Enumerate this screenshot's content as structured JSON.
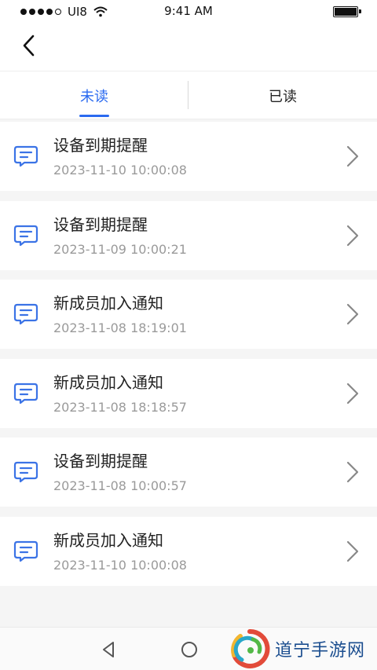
{
  "status_bar": {
    "carrier": "UI8",
    "time": "9:41 AM"
  },
  "tabs": [
    {
      "label": "未读"
    },
    {
      "label": "已读"
    }
  ],
  "messages": [
    {
      "title": "设备到期提醒",
      "time": "2023-11-10 10:00:08"
    },
    {
      "title": "设备到期提醒",
      "time": "2023-11-09 10:00:21"
    },
    {
      "title": "新成员加入通知",
      "time": "2023-11-08 18:19:01"
    },
    {
      "title": "新成员加入通知",
      "time": "2023-11-08 18:18:57"
    },
    {
      "title": "设备到期提醒",
      "time": "2023-11-08 10:00:57"
    },
    {
      "title": "新成员加入通知",
      "time": "2023-11-10 10:00:08"
    }
  ],
  "watermark": {
    "text": "道宁手游网"
  },
  "colors": {
    "accent": "#2a6af0",
    "icon": "#3b73e6"
  }
}
